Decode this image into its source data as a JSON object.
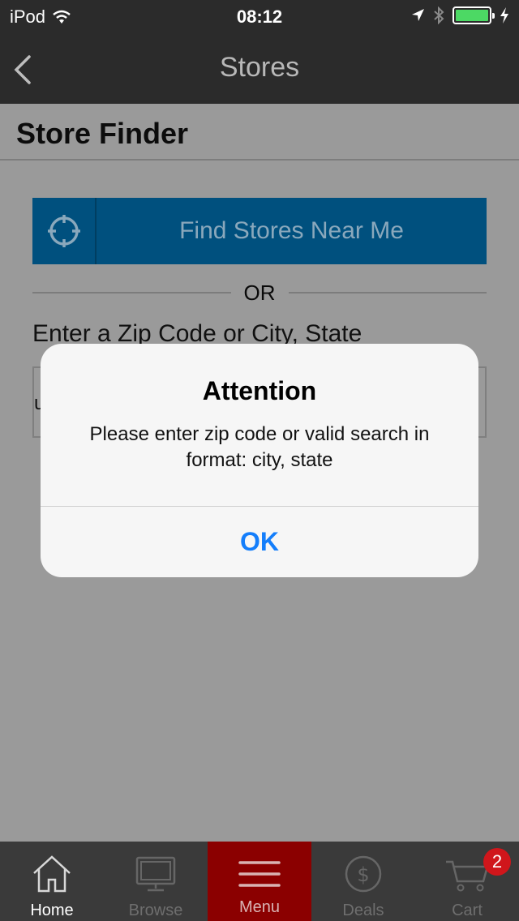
{
  "status_bar": {
    "device": "iPod",
    "time": "08:12"
  },
  "nav": {
    "title": "Stores"
  },
  "page": {
    "title": "Store Finder"
  },
  "find_button": {
    "label": "Find Stores Near Me"
  },
  "separator": {
    "text": "OR"
  },
  "zip": {
    "label": "Enter a Zip Code or City, State",
    "value": "u"
  },
  "alert": {
    "title": "Attention",
    "message": "Please enter zip code or valid search in format: city, state",
    "ok_label": "OK"
  },
  "tabbar": {
    "items": [
      {
        "label": "Home",
        "icon": "home-icon"
      },
      {
        "label": "Browse",
        "icon": "monitor-icon"
      },
      {
        "label": "Menu",
        "icon": "menu-icon"
      },
      {
        "label": "Deals",
        "icon": "dollar-icon"
      },
      {
        "label": "Cart",
        "icon": "cart-icon"
      }
    ],
    "cart_count": "2"
  },
  "colors": {
    "find_button_bg": "#00507e",
    "menu_active_bg": "#8b0000",
    "alert_ok": "#147efb",
    "badge": "#d0161b"
  }
}
